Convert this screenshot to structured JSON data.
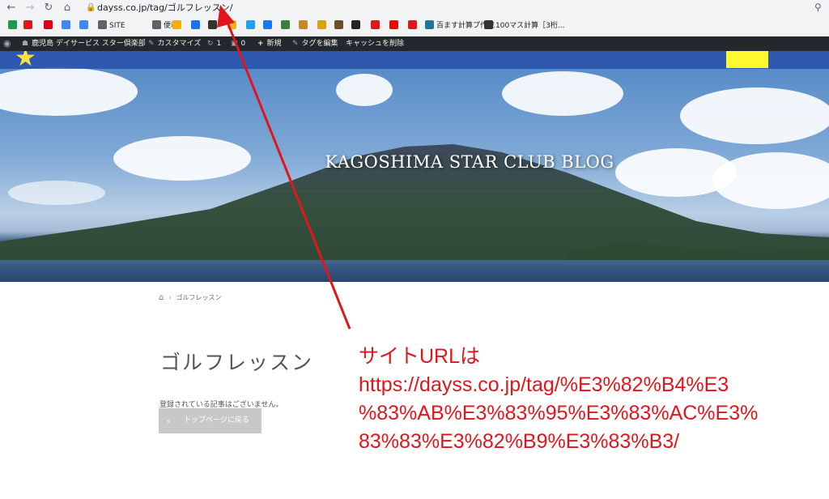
{
  "browser": {
    "url": "dayss.co.jp/tag/ゴルフレッスン/",
    "bookmarks": [
      {
        "label": "",
        "icon": "google-drive-icon",
        "color": "#1a9c4a"
      },
      {
        "label": "",
        "icon": "flower-icon",
        "color": "#e0161b"
      },
      {
        "label": "",
        "icon": "yahoo-icon",
        "color": "#d6001c"
      },
      {
        "label": "",
        "icon": "google-icon",
        "color": "#4285f4"
      },
      {
        "label": "",
        "icon": "translate-icon",
        "color": "#4285f4"
      },
      {
        "label": "SITE",
        "icon": "folder-icon",
        "color": "#5f6368"
      },
      {
        "label": "便利",
        "icon": "folder-icon",
        "color": "#5f6368"
      },
      {
        "label": "",
        "icon": "analytics-icon",
        "color": "#f9ab00"
      },
      {
        "label": "",
        "icon": "wifi-icon",
        "color": "#1a73e8"
      },
      {
        "label": "",
        "icon": "globe-icon",
        "color": "#333333"
      },
      {
        "label": "",
        "icon": "star-icon",
        "color": "#f2b01e"
      },
      {
        "label": "",
        "icon": "twitter-icon",
        "color": "#1da1f2"
      },
      {
        "label": "",
        "icon": "facebook-icon",
        "color": "#1877f2"
      },
      {
        "label": "",
        "icon": "tool-icon",
        "color": "#3b7f3b"
      },
      {
        "label": "",
        "icon": "u-icon",
        "color": "#c48a1f"
      },
      {
        "label": "",
        "icon": "cat-icon",
        "color": "#d9a400"
      },
      {
        "label": "",
        "icon": "image-icon",
        "color": "#6b4f2a"
      },
      {
        "label": "",
        "icon": "panda-icon",
        "color": "#222222"
      },
      {
        "label": "",
        "icon": "record-icon",
        "color": "#e0161b"
      },
      {
        "label": "",
        "icon": "youtube-icon",
        "color": "#ff0000"
      },
      {
        "label": "",
        "icon": "red-icon",
        "color": "#e0161b"
      },
      {
        "label": "百ます計算プ作成",
        "icon": "wordpress-icon",
        "color": "#21759b"
      },
      {
        "label": "100マス計算［3桁...",
        "icon": "site-icon",
        "color": "#333333"
      }
    ]
  },
  "adminbar": {
    "site_name": "鹿児島 デイサービス スター倶楽部",
    "customize": "カスタマイズ",
    "updates": "1",
    "comments": "0",
    "new": "新規",
    "edit_tag": "タグを編集",
    "clear_cache": "キャッシュを削除"
  },
  "hero": {
    "title": "KAGOSHIMA STAR CLUB BLOG"
  },
  "breadcrumb": {
    "current": "ゴルフレッスン"
  },
  "page": {
    "title": "ゴルフレッスン",
    "empty_message": "登録されている記事はございません。",
    "back_button": "トップページに戻る"
  },
  "annotation": {
    "line1": "サイトURLは",
    "line2": "https://dayss.co.jp/tag/%E3%82%B4%E3",
    "line3": "%83%AB%E3%83%95%E3%83%AC%E3%",
    "line4": "83%83%E3%82%B9%E3%83%B3/",
    "color": "#e0161b"
  }
}
